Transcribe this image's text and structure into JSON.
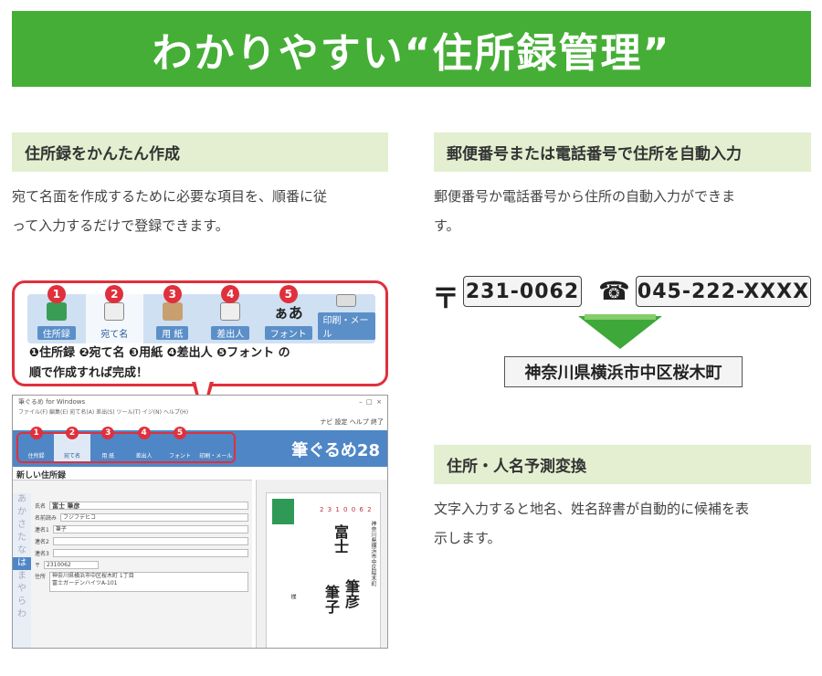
{
  "banner": {
    "title": "わかりやすい“住所録管理”"
  },
  "section_left": {
    "heading": "住所録をかんたん作成",
    "body_line1": "宛て名面を作成するために必要な項目を、順番に従",
    "body_line2": "って入力するだけで登録できます。"
  },
  "section_right_top": {
    "heading": "郵便番号または電話番号で住所を自動入力",
    "body_line1": "郵便番号か電話番号から住所の自動入力ができま",
    "body_line2": "す。"
  },
  "section_right_bottom": {
    "heading": "住所・人名予測変換",
    "body_line1": "文字入力すると地名、姓名辞書が自動的に候補を表",
    "body_line2": "示します。"
  },
  "callout": {
    "tabs": [
      {
        "num": "1",
        "label": "住所録",
        "icon": "book-icon"
      },
      {
        "num": "2",
        "label": "宛て名",
        "icon": "postcard-pen-icon"
      },
      {
        "num": "3",
        "label": "用 紙",
        "icon": "paper-icon"
      },
      {
        "num": "4",
        "label": "差出人",
        "icon": "sender-icon"
      },
      {
        "num": "5",
        "label": "フォント",
        "icon": "font-icon"
      },
      {
        "num": "",
        "label": "印刷・メール",
        "icon": "printer-icon"
      }
    ],
    "font_glyph": "ぁあ",
    "steps_line": "❶住所録 ❷宛て名 ❸用紙 ❹差出人 ❺フォント の",
    "steps_line2": "順で作成すれば完成！"
  },
  "app": {
    "window_title": "筆ぐるめ for Windows",
    "menu": "ファイル(F)  編集(E)  宛て名(A)  差出(S)  ツール(T)  イジ(N)  ヘルプ(H)",
    "toolbar_right": "ナビ  設定  ヘルプ  終了",
    "brand": "筆ぐるめ28",
    "tabs": [
      "住所録",
      "宛て名",
      "用 紙",
      "差出人",
      "フォント",
      "印刷・メール"
    ],
    "tab_nums": [
      "1",
      "2",
      "3",
      "4",
      "5"
    ],
    "form_title": "新しい住所録",
    "kana": [
      "あ",
      "か",
      "さ",
      "た",
      "な",
      "は",
      "ま",
      "や",
      "ら",
      "わ"
    ],
    "fields": {
      "name_label": "氏名",
      "name_value": "富士 筆彦",
      "kana_label": "名前読み",
      "kana_value": "フジフデヒコ",
      "joint1_label": "連名1",
      "joint1_value": "筆子",
      "joint2_label": "連名2",
      "joint3_label": "連名3",
      "zip_label": "〒",
      "zip_value": "2310062",
      "address_label": "住所",
      "address_value": "神奈川県横浜市中区桜木町 1丁目",
      "address_value2": "富士ガーデンハイツA-101"
    },
    "postcard": {
      "zip": "2 3 1 0 0 6 2",
      "name1": "富士",
      "name2": "筆彦",
      "name3": "筆子",
      "address": "神奈川県横浜市中区桜木町",
      "honor": "様"
    }
  },
  "autofill": {
    "zip_symbol": "〒",
    "zip_value": "231-0062",
    "phone_symbol": "☎",
    "phone_value": "045-222-XXXX",
    "result": "神奈川県横浜市中区桜木町"
  },
  "colors": {
    "brand_green": "#45ae36",
    "heading_bg": "#e3efd0",
    "accent_red": "#e0303c",
    "app_blue": "#4f86c6"
  }
}
